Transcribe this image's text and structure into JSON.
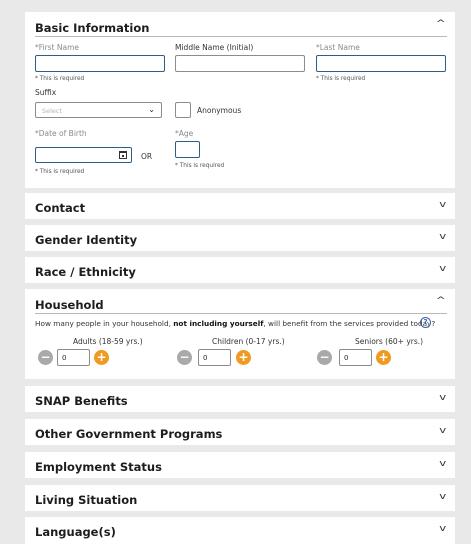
{
  "basic": {
    "title": "Basic Information",
    "first_name_label": "*First Name",
    "middle_name_label": "Middle Name (Initial)",
    "last_name_label": "*Last Name",
    "required_hint": "* This is required",
    "suffix_label": "Suffix",
    "suffix_placeholder": "Select",
    "anonymous_label": "Anonymous",
    "dob_label": "*Date of Birth",
    "or_label": "OR",
    "age_label": "*Age"
  },
  "sections": {
    "contact": "Contact",
    "gender": "Gender Identity",
    "race": "Race / Ethnicity",
    "snap": "SNAP Benefits",
    "gov": "Other Government Programs",
    "employment": "Employment Status",
    "living": "Living Situation",
    "language": "Language(s)"
  },
  "household": {
    "title": "Household",
    "question_pre": "How many people in your household, ",
    "question_bold": "not including yourself",
    "question_post": ", will benefit from the services provided today?",
    "help_glyph": "?",
    "adults_label": "Adults (18-59 yrs.)",
    "children_label": "Children (0-17 yrs.)",
    "seniors_label": "Seniors (60+ yrs.)",
    "adults_value": "0",
    "children_value": "0",
    "seniors_value": "0",
    "minus": "−",
    "plus": "+"
  },
  "icons": {
    "chevron_up": "^",
    "chevron_down": "v",
    "dropdown": "⌄"
  }
}
